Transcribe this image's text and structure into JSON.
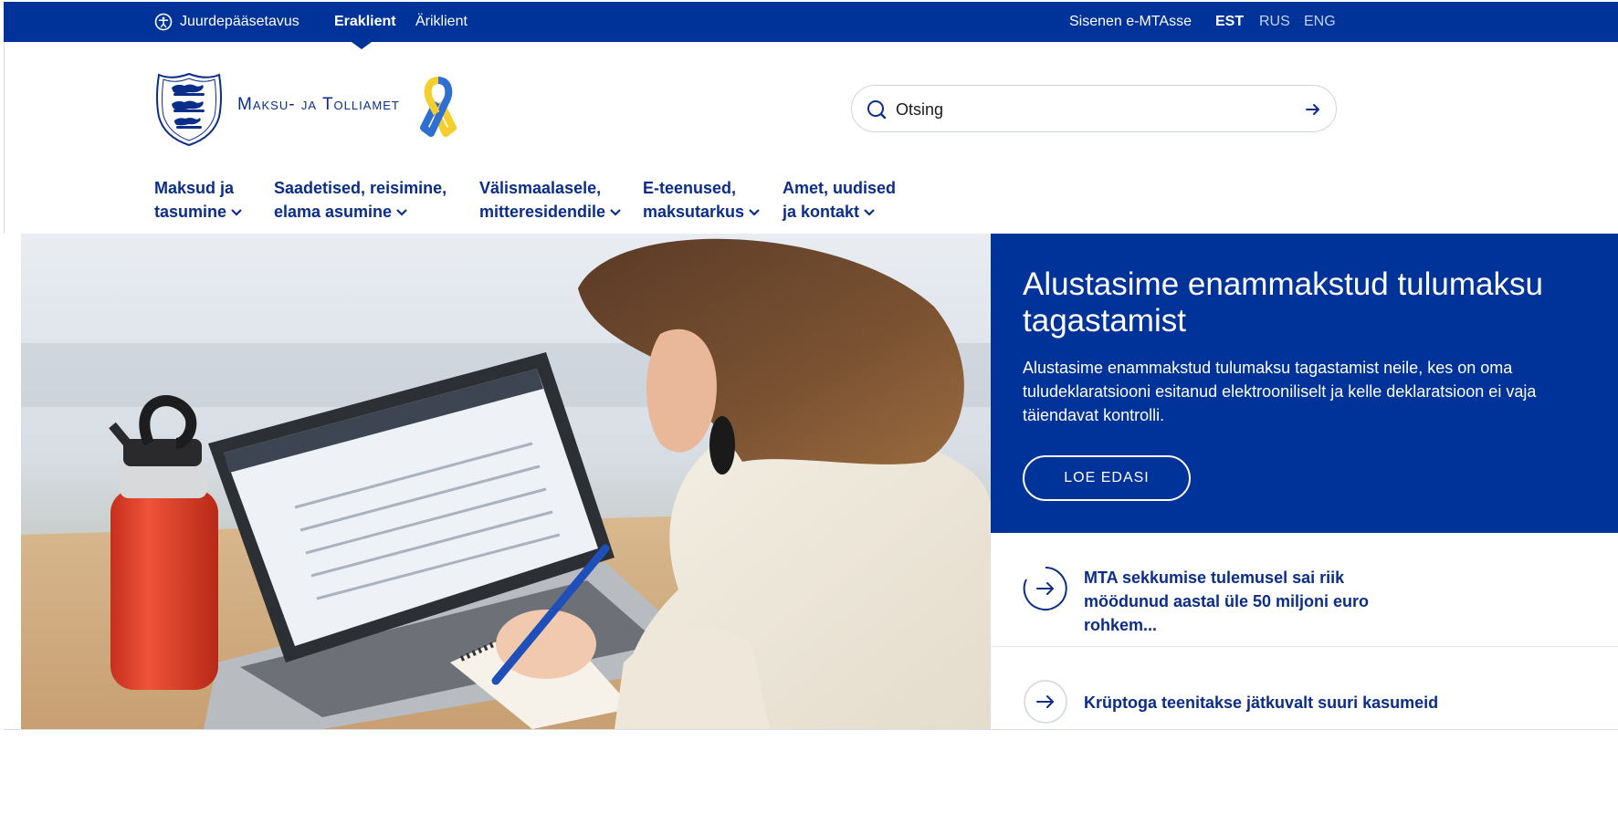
{
  "topbar": {
    "accessibility_label": "Juurdepääsetavus",
    "tabs": [
      {
        "label": "Eraklient",
        "active": true
      },
      {
        "label": "Äriklient",
        "active": false
      }
    ],
    "login_label": "Sisenen e-MTAsse",
    "languages": [
      {
        "label": "EST",
        "active": true
      },
      {
        "label": "RUS",
        "active": false
      },
      {
        "label": "ENG",
        "active": false
      }
    ]
  },
  "header": {
    "brand_name": "Maksu- ja Tolliamet",
    "logo_icon": "estonian-coat-of-arms",
    "ribbon_icon": "ukraine-support-ribbon",
    "search": {
      "placeholder": "Otsing",
      "search_icon": "search-icon",
      "submit_icon": "arrow-right-icon"
    }
  },
  "nav": {
    "items": [
      {
        "line1": "Maksud ja",
        "line2": "tasumine"
      },
      {
        "line1": "Saadetised, reisimine,",
        "line2": "elama asumine"
      },
      {
        "line1": "Välismaalasele,",
        "line2": "mitteresidendile"
      },
      {
        "line1": "E-teenused,",
        "line2": "maksutarkus"
      },
      {
        "line1": "Amet, uudised",
        "line2": "ja kontakt"
      }
    ]
  },
  "hero": {
    "title": "Alustasime enammakstud tulumaksu tagastamist",
    "text": "Alustasime enammakstud tulumaksu tagastamist neile, kes on oma tuludeklaratsiooni esitanud elektrooniliselt ja kelle deklaratsioon ei vaja täiendavat kontrolli.",
    "button_label": "LOE EDASI"
  },
  "news": [
    {
      "title": "MTA sekkumise tulemusel sai riik möödunud aastal üle 50 miljoni euro rohkem..."
    },
    {
      "title": "Krüptoga teenitakse jätkuvalt suuri kasumeid"
    }
  ],
  "colors": {
    "brand_blue": "#003399",
    "text_blue": "#0b2d8a",
    "ribbon_blue": "#2f6fd1",
    "ribbon_yellow": "#f5cf2e",
    "bottle_red": "#e8432e"
  }
}
